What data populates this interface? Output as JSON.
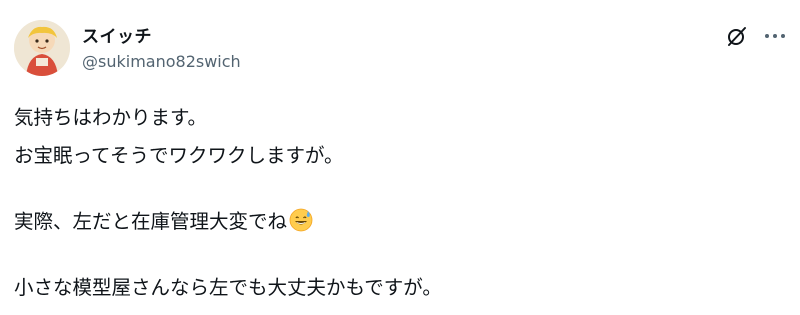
{
  "author": {
    "display_name": "スイッチ",
    "handle": "@sukimano82swich"
  },
  "icons": {
    "grok": "grok-slash-circle-icon",
    "more": "more-horizontal-icon",
    "emoji": "grinning-sweat-emoji"
  },
  "post": {
    "lines": [
      "気持ちはわかります。",
      "お宝眠ってそうでワクワクしますが。",
      "実際、左だと在庫管理大変でね",
      "小さな模型屋さんなら左でも大丈夫かもですが。"
    ]
  },
  "colors": {
    "text": "#0f1419",
    "secondary": "#536471",
    "background": "#ffffff"
  }
}
